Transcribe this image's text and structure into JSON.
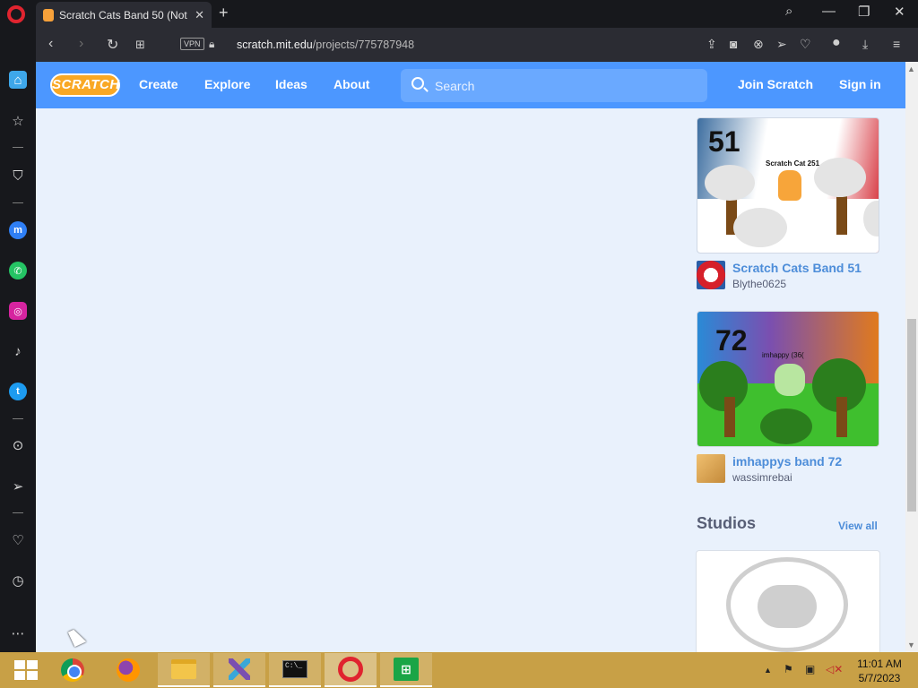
{
  "browser": {
    "tab_title": "Scratch Cats Band 50 (Not",
    "new_tab": "+",
    "url_domain": "scratch.mit.edu",
    "url_path": "/projects/775787948",
    "vpn_label": "VPN"
  },
  "scratch_nav": {
    "logo": "SCRATCH",
    "links": [
      "Create",
      "Explore",
      "Ideas",
      "About"
    ],
    "search_placeholder": "Search",
    "join": "Join Scratch",
    "signin": "Sign in"
  },
  "projects": [
    {
      "title": "Scratch Cats Band 51",
      "author": "Blythe0625",
      "thumb_number": "51",
      "thumb_caption": "Scratch Cat 251"
    },
    {
      "title": "imhappys band 72",
      "author": "wassimrebai",
      "thumb_number": "72",
      "thumb_caption": "imhappy (36("
    }
  ],
  "studios": {
    "heading": "Studios",
    "view_all": "View all"
  },
  "taskbar": {
    "cmd_text": "C:\\_",
    "store_text": "⊞",
    "time": "11:01 AM",
    "date": "5/7/2023"
  },
  "colors": {
    "scratch_blue": "#4c97ff",
    "page_bg": "#e9f1fc",
    "link_blue": "#4d8dd9",
    "taskbar": "#c8a046"
  }
}
